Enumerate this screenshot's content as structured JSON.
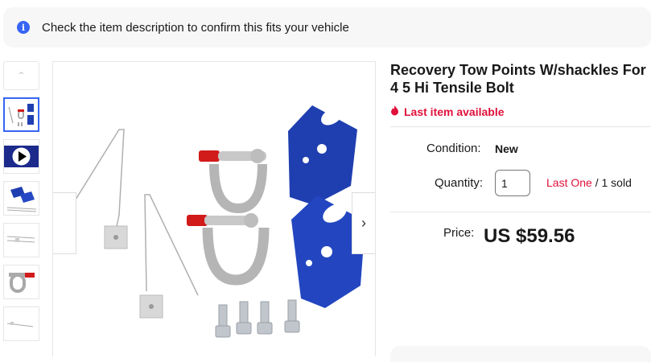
{
  "notice": {
    "icon": "info-icon",
    "text": "Check the item description to confirm this fits your vehicle"
  },
  "gallery": {
    "thumbnails": [
      {
        "name": "thumbnail-kit-all-parts"
      },
      {
        "name": "thumbnail-video"
      },
      {
        "name": "thumbnail-blue-brackets"
      },
      {
        "name": "thumbnail-wires"
      },
      {
        "name": "thumbnail-shackle"
      },
      {
        "name": "thumbnail-wire-pin"
      }
    ],
    "next_icon": "chevron-right-icon"
  },
  "listing": {
    "title": "Recovery Tow Points W/shackles For 4 5 Hi Tensile Bolt",
    "last_item": "Last item available",
    "condition_label": "Condition:",
    "condition_value": "New",
    "quantity_label": "Quantity:",
    "quantity_value": "1",
    "availability_red": "Last One",
    "availability_rest": " / 1 sold",
    "price_label": "Price:",
    "price_value": "US $59.56"
  },
  "colors": {
    "accent": "#3665f3",
    "alert_red": "#e0103a",
    "bracket_blue": "#1f3fb0",
    "shackle_red": "#d11a1a"
  }
}
